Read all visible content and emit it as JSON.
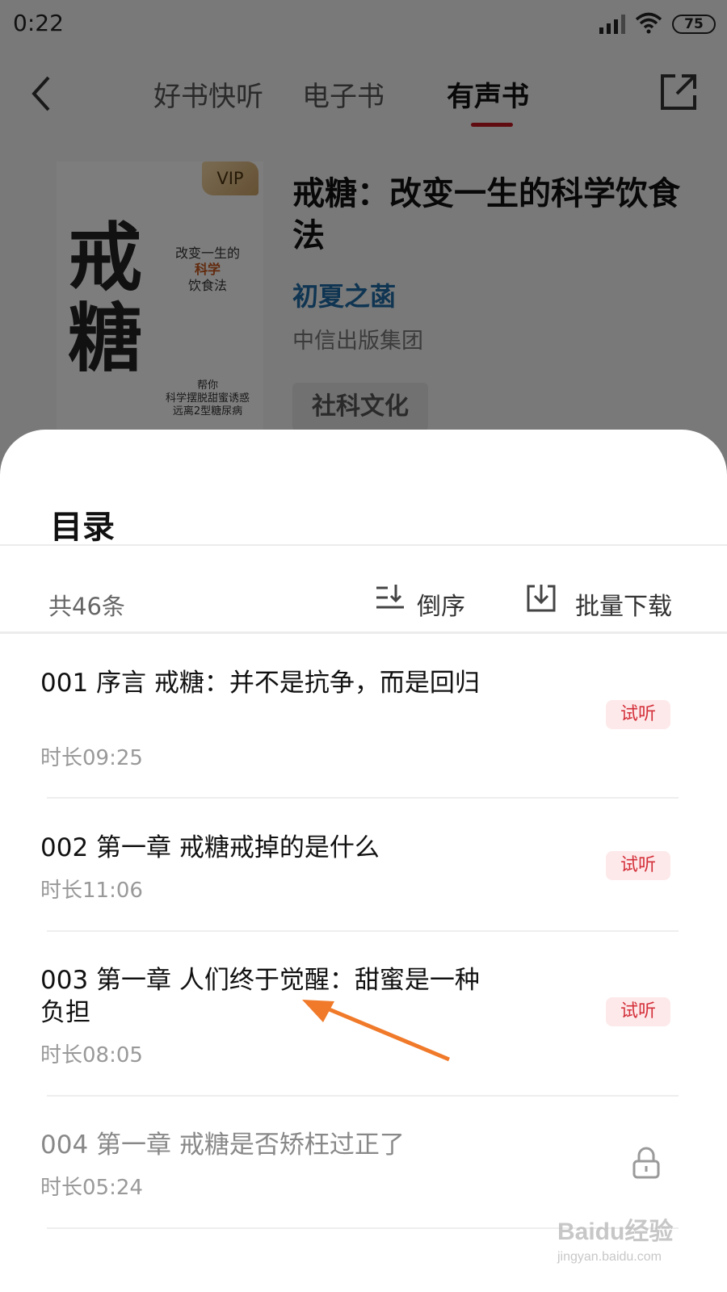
{
  "status_bar": {
    "time": "0:22",
    "battery": "75"
  },
  "nav": {
    "tabs": [
      {
        "label": "好书快听",
        "active": false
      },
      {
        "label": "电子书",
        "active": false
      },
      {
        "label": "有声书",
        "active": true
      }
    ]
  },
  "book": {
    "cover": {
      "big_chars": [
        "戒",
        "糖"
      ],
      "tagline_1": "改变一生的",
      "tagline_2": "科学",
      "tagline_3": "饮食法",
      "blurb_1": "帮你",
      "blurb_2": "科学摆脱甜蜜诱惑",
      "blurb_3": "远离2型糖尿病"
    },
    "vip_label": "VIP",
    "title": "戒糖：改变一生的科学饮食法",
    "author": "初夏之菡",
    "publisher": "中信出版集团",
    "tag": "社科文化"
  },
  "catalog": {
    "title": "目录",
    "count": "共46条",
    "sort_label": "倒序",
    "download_label": "批量下载",
    "episodes": [
      {
        "title": "001 序言 戒糖：并不是抗争，而是回归",
        "duration": "时长09:25",
        "badge": "试听",
        "locked": false
      },
      {
        "title": "002 第一章 戒糖戒掉的是什么",
        "duration": "时长11:06",
        "badge": "试听",
        "locked": false
      },
      {
        "title": "003 第一章 人们终于觉醒：甜蜜是一种负担",
        "duration": "时长08:05",
        "badge": "试听",
        "locked": false
      },
      {
        "title": "004 第一章 戒糖是否矫枉过正了",
        "duration": "时长05:24",
        "badge": "",
        "locked": true
      }
    ]
  },
  "watermark": {
    "logo": "Baidu经验",
    "url": "jingyan.baidu.com"
  },
  "colors": {
    "accent_red": "#c0161f",
    "author_blue": "#1f6aa5",
    "trial_bg": "#fde9ea",
    "trial_text": "#d4303a",
    "arrow_orange": "#f07a2a"
  }
}
